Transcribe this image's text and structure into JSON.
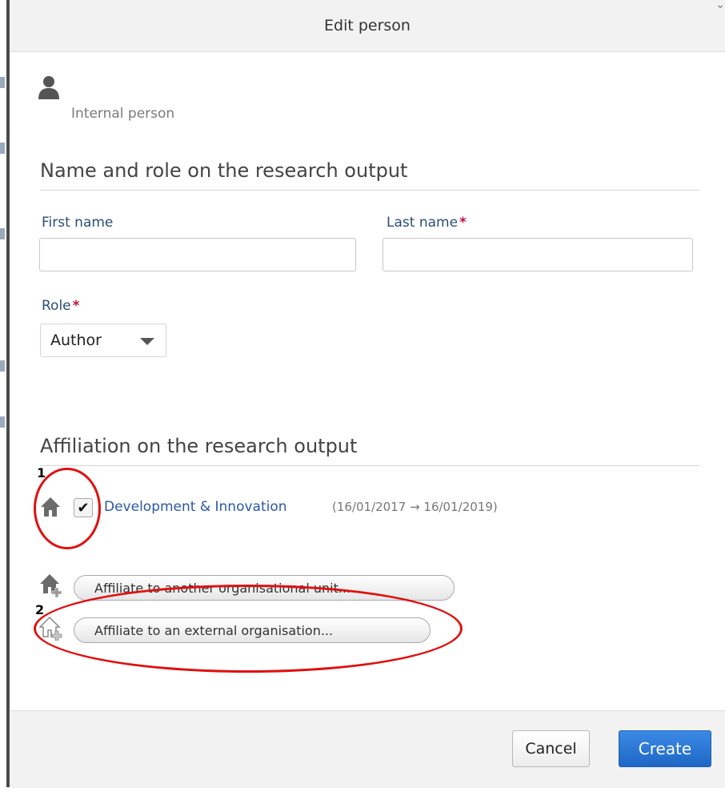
{
  "dialog": {
    "title": "Edit person"
  },
  "person": {
    "type": "Internal person",
    "icon": "person-icon"
  },
  "name_section": {
    "heading": "Name and role on the research output",
    "first_name_label": "First name",
    "first_name_value": "",
    "last_name_label": "Last name",
    "last_name_value": "",
    "required_mark": "*",
    "role_label": "Role",
    "role_value": "Author"
  },
  "affiliation_section": {
    "heading": "Affiliation on the research output",
    "units": [
      {
        "name": "Development & Innovation",
        "dates": "(16/01/2017 → 16/01/2019)",
        "checked": true,
        "checkmark": "✔"
      }
    ],
    "add_internal_label": "Affiliate to another organisational unit...",
    "add_external_label": "Affiliate to an external organisation..."
  },
  "annotations": {
    "marker_1": "1",
    "marker_2": "2",
    "color": "#e01010"
  },
  "footer": {
    "cancel_label": "Cancel",
    "create_label": "Create"
  },
  "colors": {
    "primary": "#1f66c5",
    "link": "#2a58a8",
    "required": "#c0143c"
  }
}
